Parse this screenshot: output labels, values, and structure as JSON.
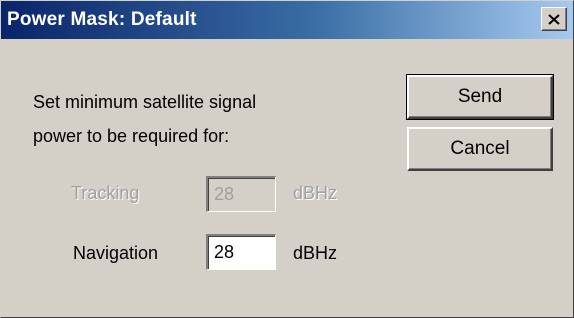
{
  "window": {
    "title": "Power Mask: Default",
    "close_icon": "close-icon"
  },
  "prompt": {
    "line1": "Set minimum satellite signal",
    "line2": "power to be required for:"
  },
  "buttons": {
    "send_label": "Send",
    "cancel_label": "Cancel"
  },
  "tracking": {
    "label": "Tracking",
    "value": "28",
    "unit": "dBHz",
    "enabled": false
  },
  "navigation": {
    "label": "Navigation",
    "value": "28",
    "unit": "dBHz",
    "enabled": true
  },
  "colors": {
    "title_gradient_start": "#0a246a",
    "title_gradient_end": "#a6caf0",
    "face": "#d4d0c8",
    "disabled_text": "#a0a0a0"
  }
}
